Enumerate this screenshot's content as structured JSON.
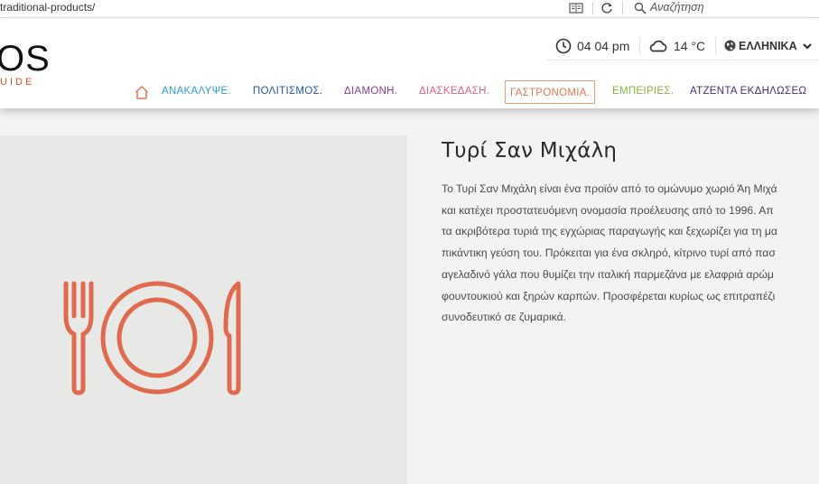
{
  "browser": {
    "url": "traditional-products/",
    "search_placeholder": "Αναζήτηση"
  },
  "header": {
    "logo_text": "OS",
    "logo_subtext": "UIDE",
    "time": "04 04 pm",
    "temperature": "14 °C",
    "language": "ΕΛΛΗΝΙΚΑ"
  },
  "nav": {
    "items": [
      {
        "label": "ΑΝΑΚΑΛΥΨΕ.",
        "color": "#2f9ad6"
      },
      {
        "label": "ΠΟΛΙΤΙΣΜΟΣ.",
        "color": "#2455a4"
      },
      {
        "label": "ΔΙΑΜΟΝΗ.",
        "color": "#8a3d8f"
      },
      {
        "label": "ΔΙΑΣΚΕΔΑΣΗ.",
        "color": "#e0607a"
      },
      {
        "label": "ΓΑΣΤΡΟΝΟΜΙΑ.",
        "color": "#e2794d"
      },
      {
        "label": "ΕΜΠΕΙΡΙΕΣ.",
        "color": "#7fb43f"
      },
      {
        "label": "ΑΤΖΕΝΤΑ ΕΚΔΗΛΩΣΕΩ",
        "color": "#4b2a7a"
      }
    ],
    "active": "ΓΑΣΤΡΟΝΟΜΙΑ."
  },
  "article": {
    "title": "Τυρί Σαν Μιχάλη",
    "lines": [
      "Το Τυρί Σαν Μιχάλη είναι ένα προϊόν από το ομώνυμο χωριό Άη Μιχά",
      "και κατέχει προστατευόμενη ονομασία προέλευσης από το 1996. Απ",
      "τα ακριβότερα τυριά της εγχώριας παραγωγής και ξεχωρίζει για τη μα",
      "πικάντικη γεύση του. Πρόκειται για ένα σκληρό, κίτρινο τυρί από πασ",
      "αγελαδινό γάλα που θυμίζει την ιταλική παρμεζάνα με ελαφριά αρώμ",
      "φουντουκιού και ξηρών καρπών. Προσφέρεται κυρίως ως επιτραπέζι",
      "συνοδευτικό σε ζυμαρικά."
    ]
  },
  "colors": {
    "accent": "#e06a4e",
    "logo_sub": "#d94f2b"
  },
  "icons": [
    "reader-view-icon",
    "reload-icon",
    "search-icon",
    "clock-icon",
    "cloud-icon",
    "globe-icon",
    "chevron-down-icon",
    "home-icon",
    "cutlery-plate-icon"
  ]
}
